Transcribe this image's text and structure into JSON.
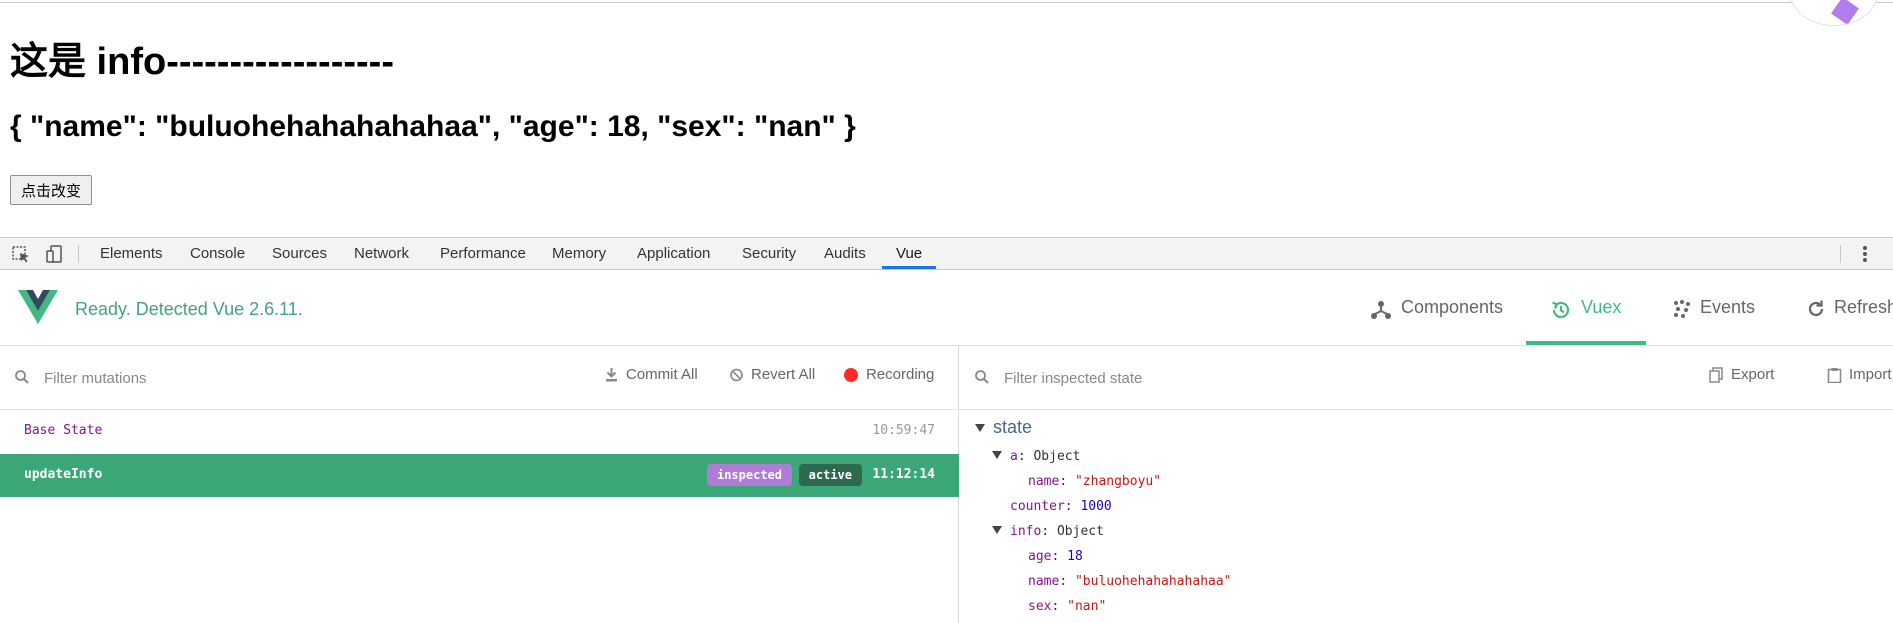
{
  "page": {
    "title": "这是 info------------------",
    "json_text": "{ \"name\": \"buluohehahahahahaa\", \"age\": 18, \"sex\": \"nan\" }",
    "button_label": "点击改变"
  },
  "devtools": {
    "tabs": [
      "Elements",
      "Console",
      "Sources",
      "Network",
      "Performance",
      "Memory",
      "Application",
      "Security",
      "Audits",
      "Vue"
    ],
    "active_tab": "Vue"
  },
  "vue_header": {
    "status": "Ready. Detected Vue 2.6.11.",
    "tabs": [
      {
        "label": "Components",
        "icon": "components-icon"
      },
      {
        "label": "Vuex",
        "icon": "history-icon"
      },
      {
        "label": "Events",
        "icon": "events-icon"
      },
      {
        "label": "Refresh",
        "icon": "refresh-icon"
      }
    ],
    "active_tab": "Vuex",
    "accent_color": "#42b983"
  },
  "mutations": {
    "filter_placeholder": "Filter mutations",
    "commit_all": "Commit All",
    "revert_all": "Revert All",
    "recording": "Recording",
    "rows": [
      {
        "name": "Base State",
        "time": "10:59:47"
      },
      {
        "name": "updateInfo",
        "time": "11:12:14",
        "badges": [
          "inspected",
          "active"
        ]
      }
    ]
  },
  "inspector": {
    "filter_placeholder": "Filter inspected state",
    "export": "Export",
    "import": "Import",
    "heading": "state",
    "tree": {
      "a_key": "a",
      "a_type": "Object",
      "a_name_key": "name",
      "a_name_value": "\"zhangboyu\"",
      "counter_key": "counter",
      "counter_value": "1000",
      "info_key": "info",
      "info_type": "Object",
      "info_age_key": "age",
      "info_age_value": "18",
      "info_name_key": "name",
      "info_name_value": "\"buluohehahahahahaa\"",
      "info_sex_key": "sex",
      "info_sex_value": "\"nan\""
    }
  }
}
